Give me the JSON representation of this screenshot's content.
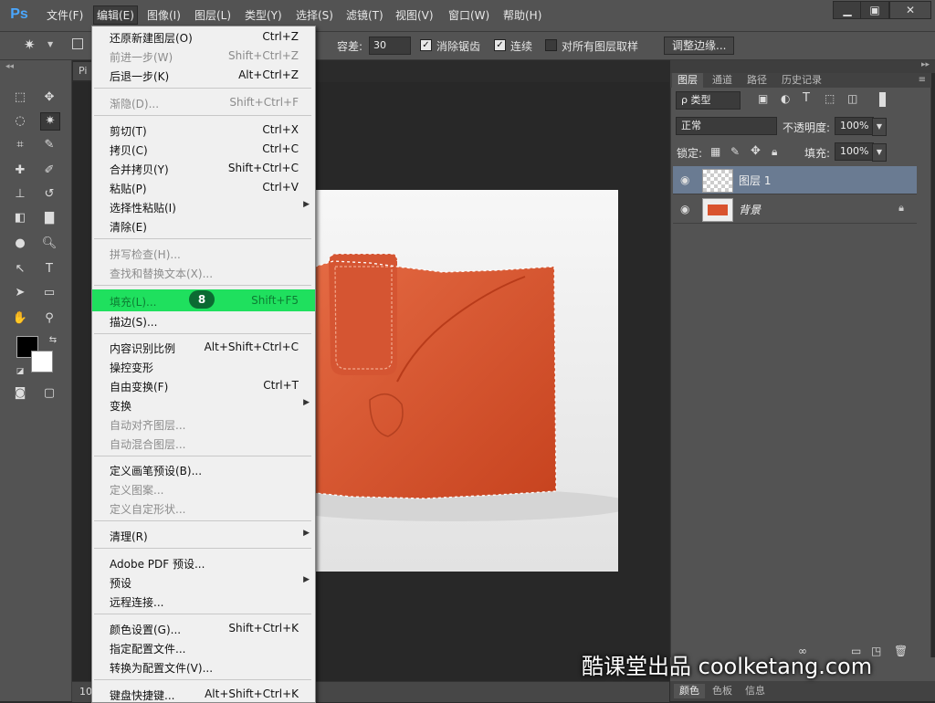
{
  "app": {
    "logo": "Ps"
  },
  "menubar": {
    "items": [
      "文件(F)",
      "编辑(E)",
      "图像(I)",
      "图层(L)",
      "类型(Y)",
      "选择(S)",
      "滤镜(T)",
      "视图(V)",
      "窗口(W)",
      "帮助(H)"
    ],
    "active": "编辑(E)",
    "window_controls": [
      "minimize-icon",
      "restore-icon",
      "close-icon"
    ]
  },
  "options": {
    "tolerance_label": "容差:",
    "tolerance_value": "30",
    "antialias_label": "消除锯齿",
    "antialias_checked": true,
    "contiguous_label": "连续",
    "contiguous_checked": true,
    "sample_all_label": "对所有图层取样",
    "sample_all_checked": false,
    "refine_edge_button": "调整边缘..."
  },
  "document": {
    "tab_label": "Pi",
    "zoom_status": "10"
  },
  "edit_menu": {
    "items": [
      {
        "label": "还原新建图层(O)",
        "shortcut": "Ctrl+Z",
        "enabled": true
      },
      {
        "label": "前进一步(W)",
        "shortcut": "Shift+Ctrl+Z",
        "enabled": false
      },
      {
        "label": "后退一步(K)",
        "shortcut": "Alt+Ctrl+Z",
        "enabled": true
      },
      {
        "label": "渐隐(D)...",
        "shortcut": "Shift+Ctrl+F",
        "enabled": false
      },
      {
        "label": "剪切(T)",
        "shortcut": "Ctrl+X",
        "enabled": true
      },
      {
        "label": "拷贝(C)",
        "shortcut": "Ctrl+C",
        "enabled": true
      },
      {
        "label": "合并拷贝(Y)",
        "shortcut": "Shift+Ctrl+C",
        "enabled": true
      },
      {
        "label": "粘贴(P)",
        "shortcut": "Ctrl+V",
        "enabled": true
      },
      {
        "label": "选择性粘贴(I)",
        "shortcut": "",
        "enabled": true,
        "submenu": true
      },
      {
        "label": "清除(E)",
        "shortcut": "",
        "enabled": true
      },
      {
        "label": "拼写检查(H)...",
        "shortcut": "",
        "enabled": false
      },
      {
        "label": "查找和替换文本(X)...",
        "shortcut": "",
        "enabled": false
      },
      {
        "label": "填充(L)...",
        "shortcut": "Shift+F5",
        "enabled": true,
        "highlighted": true
      },
      {
        "label": "描边(S)...",
        "shortcut": "",
        "enabled": true
      },
      {
        "label": "内容识别比例",
        "shortcut": "Alt+Shift+Ctrl+C",
        "enabled": true
      },
      {
        "label": "操控变形",
        "shortcut": "",
        "enabled": true
      },
      {
        "label": "自由变换(F)",
        "shortcut": "Ctrl+T",
        "enabled": true
      },
      {
        "label": "变换",
        "shortcut": "",
        "enabled": true,
        "submenu": true
      },
      {
        "label": "自动对齐图层...",
        "shortcut": "",
        "enabled": false
      },
      {
        "label": "自动混合图层...",
        "shortcut": "",
        "enabled": false
      },
      {
        "label": "定义画笔预设(B)...",
        "shortcut": "",
        "enabled": true
      },
      {
        "label": "定义图案...",
        "shortcut": "",
        "enabled": false
      },
      {
        "label": "定义自定形状...",
        "shortcut": "",
        "enabled": false
      },
      {
        "label": "清理(R)",
        "shortcut": "",
        "enabled": true,
        "submenu": true
      },
      {
        "label": "Adobe PDF 预设...",
        "shortcut": "",
        "enabled": true
      },
      {
        "label": "预设",
        "shortcut": "",
        "enabled": true,
        "submenu": true
      },
      {
        "label": "远程连接...",
        "shortcut": "",
        "enabled": true
      },
      {
        "label": "颜色设置(G)...",
        "shortcut": "Shift+Ctrl+K",
        "enabled": true
      },
      {
        "label": "指定配置文件...",
        "shortcut": "",
        "enabled": true
      },
      {
        "label": "转换为配置文件(V)...",
        "shortcut": "",
        "enabled": true
      },
      {
        "label": "键盘快捷键...",
        "shortcut": "Alt+Shift+Ctrl+K",
        "enabled": true
      }
    ],
    "step_badge": "8"
  },
  "layers_panel": {
    "tabs": [
      "图层",
      "通道",
      "路径",
      "历史记录"
    ],
    "active_tab": "图层",
    "filter_label": "ρ 类型",
    "blend_mode": "正常",
    "opacity_label": "不透明度:",
    "opacity_value": "100%",
    "lock_label": "锁定:",
    "fill_label": "填充:",
    "fill_value": "100%",
    "layers": [
      {
        "name": "图层 1",
        "selected": true,
        "locked": false
      },
      {
        "name": "背景",
        "selected": false,
        "locked": true
      }
    ]
  },
  "bottom_tabs": [
    "颜色",
    "色板",
    "信息"
  ],
  "watermark": "酷课堂出品 coolketang.com",
  "colors": {
    "ui_dark": "#535353",
    "menu_highlight": "#1fe05e",
    "layer_selected": "#6a7b92",
    "wallet": "#d9532e"
  }
}
